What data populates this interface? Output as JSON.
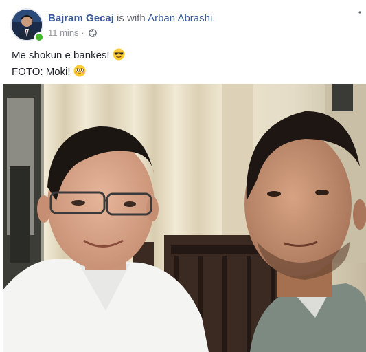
{
  "post": {
    "author_name": "Bajram Gecaj",
    "with_text": " is with ",
    "tagged_name": "Arban Abrashi.",
    "timestamp": "11 mins",
    "separator": "·",
    "privacy_icon": "globe-icon",
    "more_icon": "more-dots-icon",
    "lines": [
      {
        "text": "Me shokun e bankës!",
        "emoji": "smiling-face-with-sunglasses"
      },
      {
        "text": "FOTO: Moki!",
        "emoji": "flushed-face"
      }
    ]
  },
  "colors": {
    "author": "#385898",
    "muted": "#90949c",
    "online": "#42b72a"
  }
}
